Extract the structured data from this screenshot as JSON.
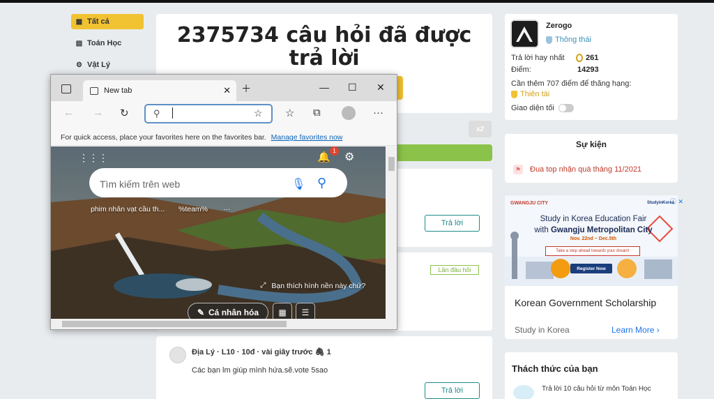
{
  "categories": [
    {
      "label": "Tất cả",
      "icon": "grid-icon",
      "active": true
    },
    {
      "label": "Toán Học",
      "icon": "calculator-icon",
      "active": false
    },
    {
      "label": "Vật Lý",
      "icon": "atom-icon",
      "active": false
    }
  ],
  "hero": {
    "title": "2375734 câu hỏi đã được trả lời"
  },
  "questions": {
    "x2_badge": "x2",
    "answer_label": "Trả lời",
    "first_tag": "Lần đầu hỏi",
    "last": {
      "meta": "Địa Lý · L10 · 10đ · vài giây trước",
      "attach": "1",
      "text": "Các bạn lm giúp mình hứa.sẽ.vote 5sao"
    }
  },
  "profile": {
    "name": "Zerogo",
    "status": "Thông thái",
    "best_answers_label": "Trả lời hay nhất",
    "best_answers_value": "261",
    "points_label": "Điểm:",
    "points_value": "14293",
    "rank_hint": "Cần thêm 707 điểm để thăng hạng:",
    "next_rank": "Thiên tài",
    "dark_mode_label": "Giao diện tối"
  },
  "events": {
    "title": "Sự kiện",
    "item": "Đua top nhận quà tháng 11/2021"
  },
  "ad": {
    "brand": "GWANGJU CITY",
    "brand2": "StudyinKorea",
    "close": "ⓘ ✕",
    "headline1": "Study in Korea Education Fair",
    "headline2_prefix": "with ",
    "headline2_bold": "Gwangju Metropolitan City",
    "dates": "Nov. 22nd ~ Dec.5th",
    "dream": "Take a step ahead towards your dream!",
    "register": "Register Now",
    "title": "Korean Government Scholarship",
    "source": "Study in Korea",
    "learn_more": "Learn More ›"
  },
  "challenge": {
    "title": "Thách thức của bạn",
    "text": "Trả lời 10 câu hỏi  từ môn Toán Học"
  },
  "browser": {
    "tab_title": "New tab",
    "favbar_text": "For quick access, place your favorites here on the favorites bar.",
    "favbar_link": "Manage favorites now",
    "search_placeholder": "Tìm kiếm trên web",
    "chips": [
      "phim nhân vạt cầu th...",
      "%team%",
      "···"
    ],
    "notif_count": "1",
    "like_bg": "Bạn thích hình nền này chứ?",
    "personalize": "Cá nhân hóa"
  },
  "colors": {
    "accent_yellow": "#f1c232",
    "green": "#8bc34a",
    "teal": "#1e8a8a"
  }
}
